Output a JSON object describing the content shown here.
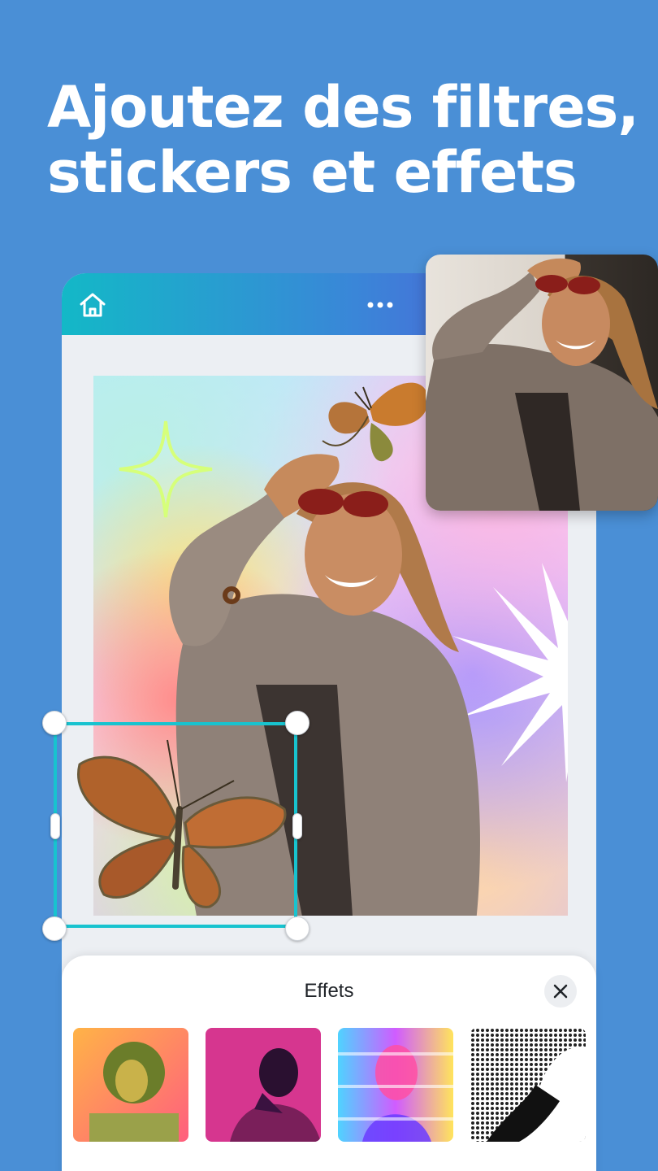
{
  "headline": {
    "line1": "Ajoutez des filtres,",
    "line2": "stickers et effets"
  },
  "app_bar": {
    "home_icon": "home-icon",
    "more_icon": "more-horizontal-icon"
  },
  "effects_panel": {
    "title": "Effets",
    "close_icon": "close-icon",
    "thumbnails": [
      {
        "name": "effect-duotone-yellow"
      },
      {
        "name": "effect-duotone-magenta"
      },
      {
        "name": "effect-glitch-rainbow"
      },
      {
        "name": "effect-halftone-mono"
      }
    ]
  },
  "colors": {
    "background": "#4a8fd6",
    "selection": "#18c3cf",
    "appbar_start": "#13b8c7",
    "appbar_end": "#5a52d6"
  }
}
